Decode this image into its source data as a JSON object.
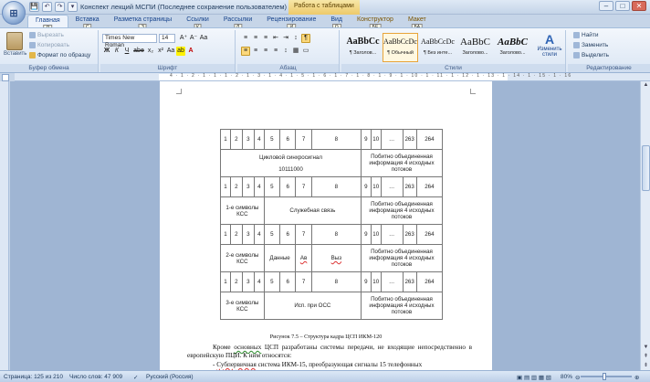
{
  "window": {
    "title": "Конспект лекций МСПИ (Последнее сохранение пользователем) [Режим огранич...",
    "context_tab_title": "Работа с таблицами",
    "office_button": "⊞",
    "qat": [
      "💾",
      "↶",
      "↷",
      "▾"
    ],
    "buttons": [
      "–",
      "□",
      "✕"
    ]
  },
  "tabs": [
    {
      "label": "Главная",
      "key": "Я"
    },
    {
      "label": "Вставка",
      "key": "С"
    },
    {
      "label": "Разметка страницы",
      "key": "З"
    },
    {
      "label": "Ссылки",
      "key": "К"
    },
    {
      "label": "Рассылки",
      "key": "Л"
    },
    {
      "label": "Рецензирование",
      "key": "И"
    },
    {
      "label": "Вид",
      "key": "О"
    },
    {
      "label": "Конструктор",
      "key": "БЕ"
    },
    {
      "label": "Макет",
      "key": "БА"
    }
  ],
  "ribbon": {
    "clipboard": {
      "label": "Буфер обмена",
      "paste": "Вставить",
      "cut": "Вырезать",
      "copy": "Копировать",
      "format_painter": "Формат по образцу"
    },
    "font": {
      "label": "Шрифт",
      "font_name": "Times New Roman",
      "font_size": "14",
      "grow": "A⁺",
      "shrink": "A⁻",
      "clear": "Aa",
      "row2": [
        "Ж",
        "К",
        "Ч",
        "abe",
        "x₂",
        "x²",
        "Aa",
        "ab",
        "A"
      ]
    },
    "paragraph": {
      "label": "Абзац",
      "row1": [
        "≡",
        "≡",
        "≡",
        "⇤",
        "⇥",
        "↕",
        "¶"
      ],
      "row2": [
        "≡",
        "≡",
        "≡",
        "≡",
        "↕",
        "▦",
        "▭"
      ]
    },
    "styles": {
      "label": "Стили",
      "items": [
        {
          "sample": "AaBbCc",
          "name": "¶ Заголов..."
        },
        {
          "sample": "AaBbCcDc",
          "name": "¶ Обычный"
        },
        {
          "sample": "AaBbCcDc",
          "name": "¶ Без инте..."
        },
        {
          "sample": "AaBbC",
          "name": "Заголово..."
        },
        {
          "sample": "AaBbC",
          "name": "Заголово..."
        }
      ],
      "change_styles": "Изменить стили"
    },
    "editing": {
      "label": "Редактирование",
      "find": "Найти",
      "replace": "Заменить",
      "select": "Выделить"
    }
  },
  "ruler": {
    "ticks": "4 · 1 · 2 · 1 · 1 · 1 · 2 · 1 · 3 · 1 · 4 · 1 · 5 · 1 · 6 · 1 · 7 · 1 · 8 · 1 · 9 · 1 · 10 · 1 · 11 · 1 · 12 · 1 · 13 · 1 · 14 · 1 · 15 · 1 · 16"
  },
  "document": {
    "frame_rows": [
      {
        "kind": "num",
        "cells": [
          "1",
          "2",
          "3",
          "4",
          "5",
          "6",
          "7",
          "8",
          "9",
          "10",
          "…",
          "263",
          "264"
        ]
      },
      {
        "kind": "desc",
        "cells": [
          "Цикловой синхросигнал",
          "10111000",
          "Побитно объединенная информация 4 исходных потоков"
        ]
      },
      {
        "kind": "num",
        "cells": [
          "1",
          "2",
          "3",
          "4",
          "5",
          "6",
          "7",
          "8",
          "9",
          "10",
          "…",
          "263",
          "264"
        ]
      },
      {
        "kind": "desc",
        "cells": [
          "1-е символы КСС",
          "Служебная связь",
          "Побитно объединенная информация 4 исходных потоков"
        ]
      },
      {
        "kind": "num",
        "cells": [
          "1",
          "2",
          "3",
          "4",
          "5",
          "6",
          "7",
          "8",
          "9",
          "10",
          "…",
          "263",
          "264"
        ]
      },
      {
        "kind": "desc",
        "cells": [
          "2-е символы КСС",
          "Данные",
          "Ав",
          "Выз",
          "Побитно объединенная информация 4 исходных потоков"
        ]
      },
      {
        "kind": "num",
        "cells": [
          "1",
          "2",
          "3",
          "4",
          "5",
          "6",
          "7",
          "8",
          "9",
          "10",
          "…",
          "263",
          "264"
        ]
      },
      {
        "kind": "desc",
        "cells": [
          "3-е символы КСС",
          "Исп. при ОСС",
          "Побитно объединенная информация 4 исходных потоков"
        ]
      }
    ],
    "caption": "Рисунок 7.5 – Структура кадра ЦСП ИКМ-120",
    "para1_a": "Кроме ",
    "para1_u": "основных",
    "para1_b": " ЦСП разработаны системы передачи, не входящие непосредственно в европейскую ПЦИ. К ним относятся:",
    "para2_a": "- ",
    "para2_u": "Субпервичная",
    "para2_b": " система ИКМ-15, преобразующая сигналы 15 телефонных"
  },
  "statusbar": {
    "page": "Страница: 125 из 210",
    "words": "Число слов: 47 909",
    "lang": "Русский (Россия)",
    "zoom": "80%"
  }
}
